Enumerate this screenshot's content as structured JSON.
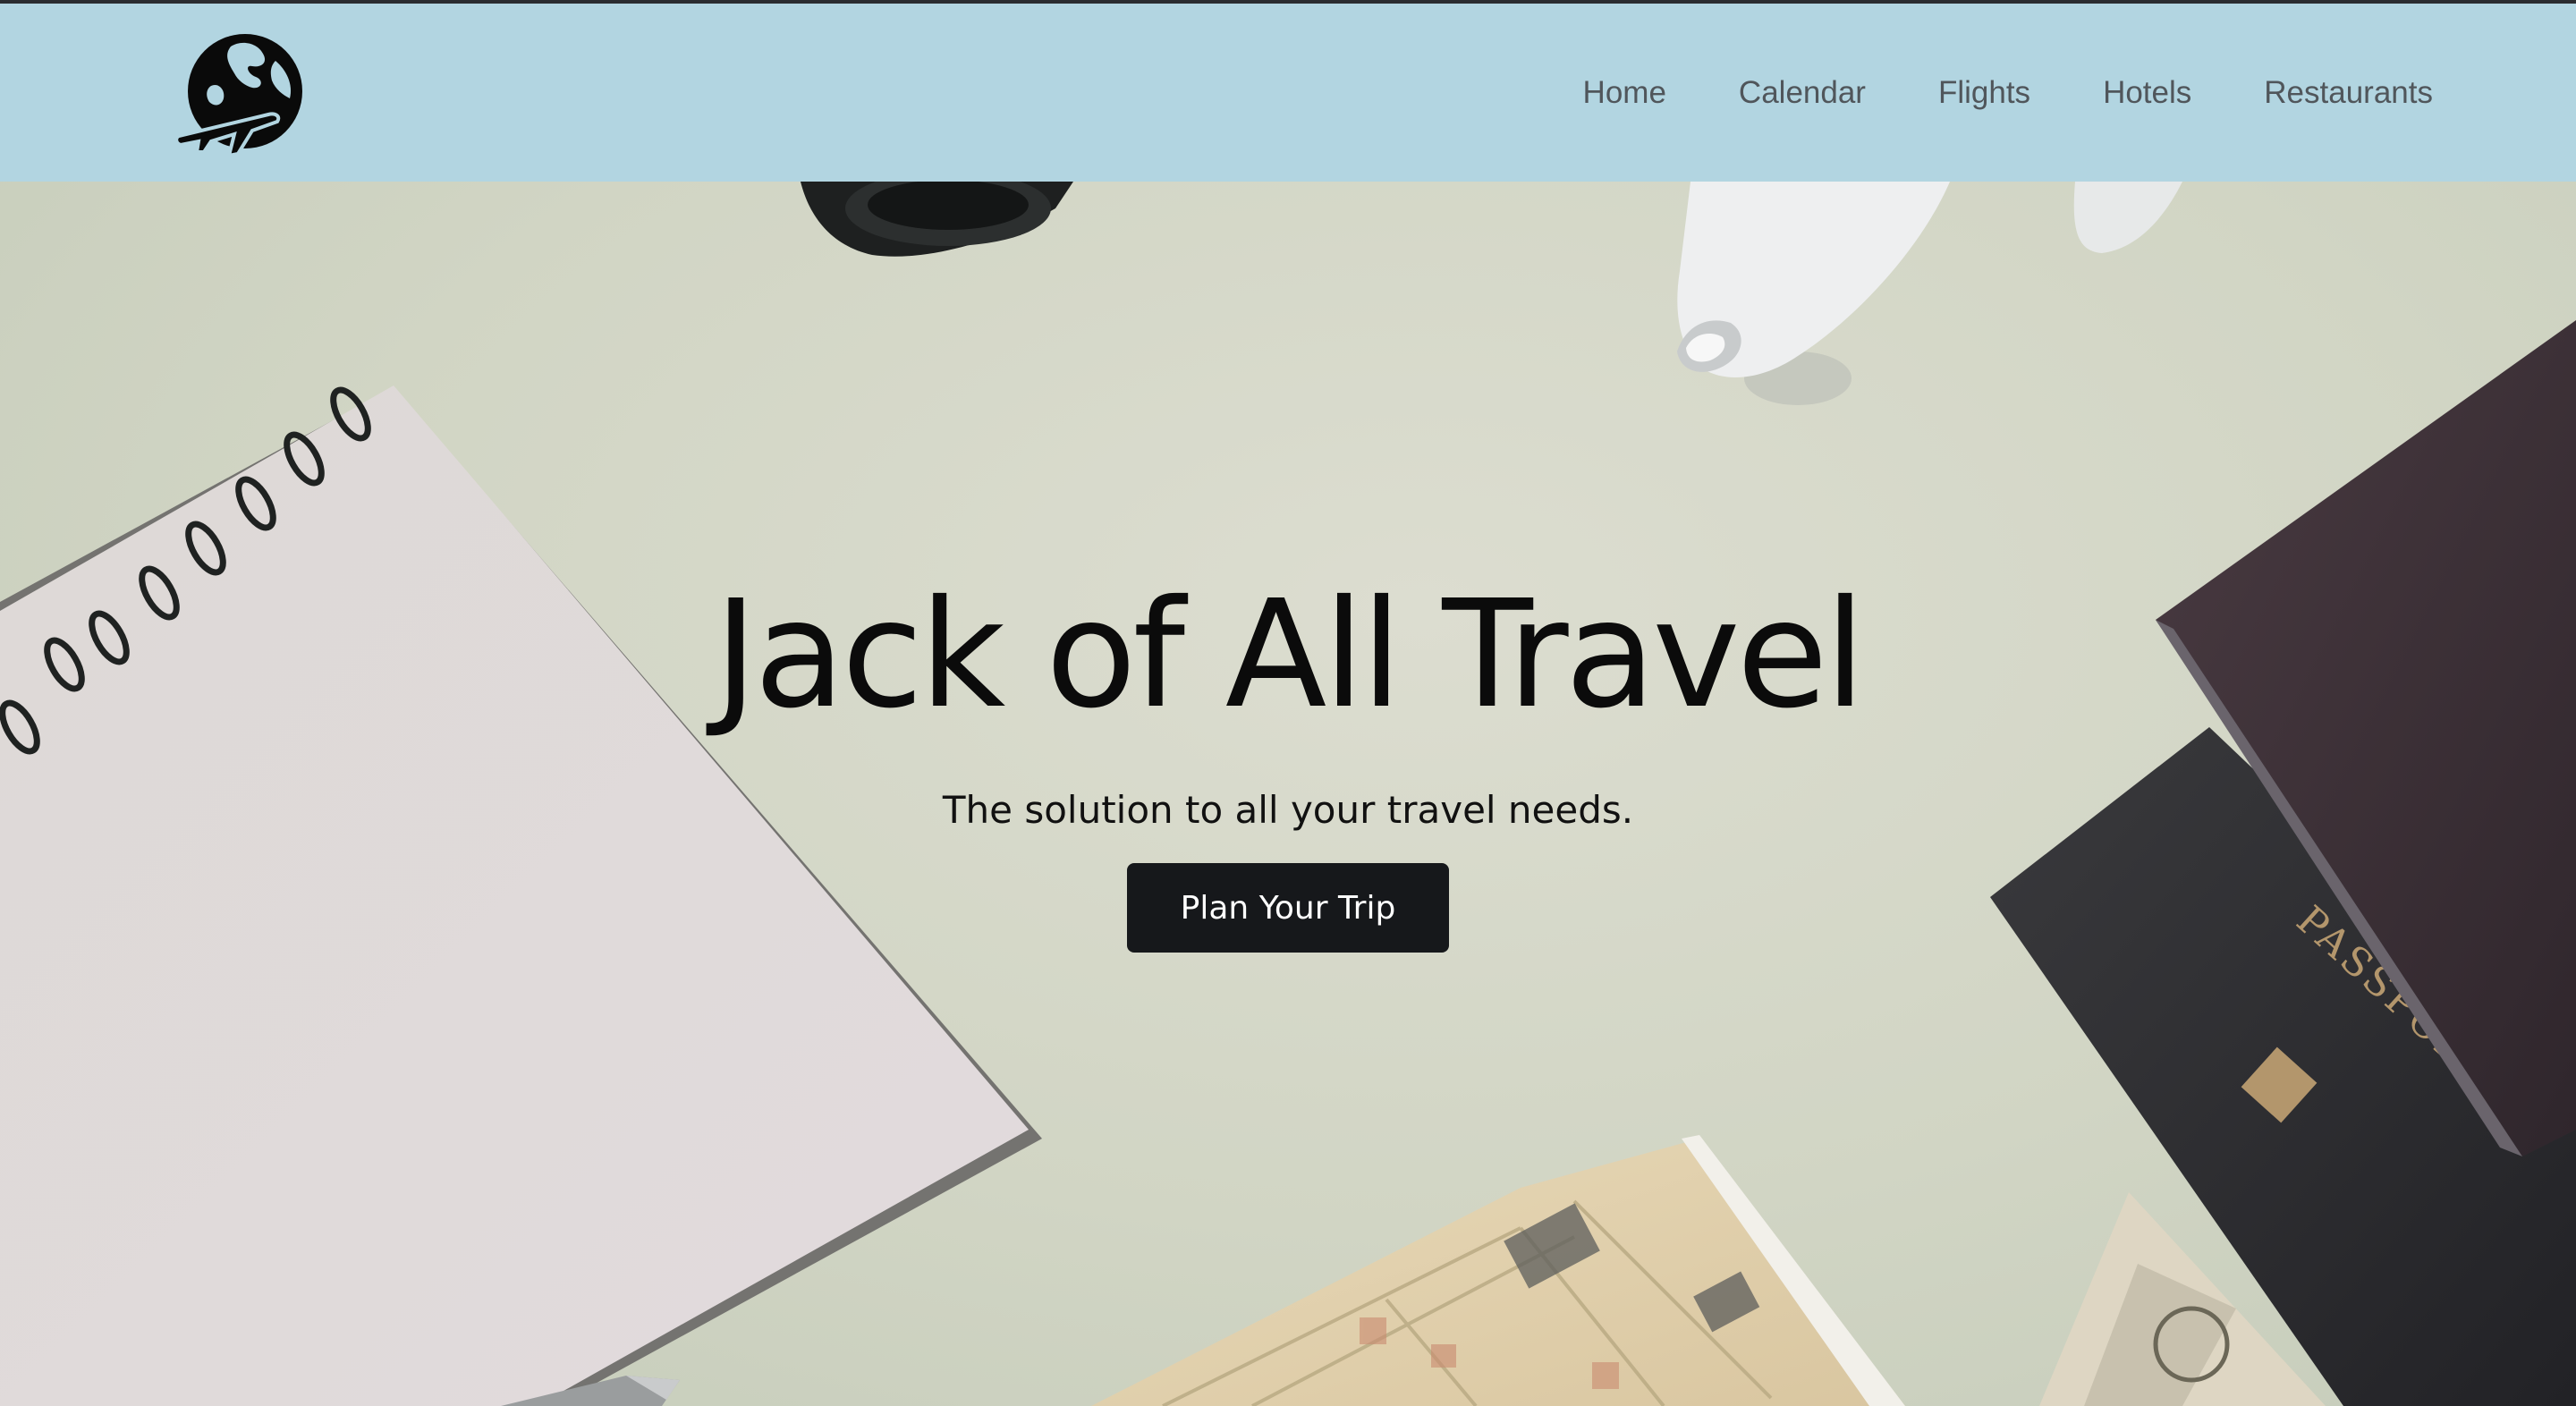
{
  "nav": {
    "logo_icon": "globe-airplane-icon",
    "items": [
      {
        "label": "Home"
      },
      {
        "label": "Calendar"
      },
      {
        "label": "Flights"
      },
      {
        "label": "Hotels"
      },
      {
        "label": "Restaurants"
      }
    ]
  },
  "hero": {
    "title": "Jack of All Travel",
    "subtitle": "The solution to all your travel needs.",
    "cta_label": "Plan Your Trip",
    "passport_text": "PASSPORT"
  },
  "colors": {
    "navbar": "#b2d5e1",
    "nav_text": "#50565b",
    "cta_background": "#16181b",
    "cta_text": "#ffffff",
    "hero_background": "#d3d6c7"
  }
}
